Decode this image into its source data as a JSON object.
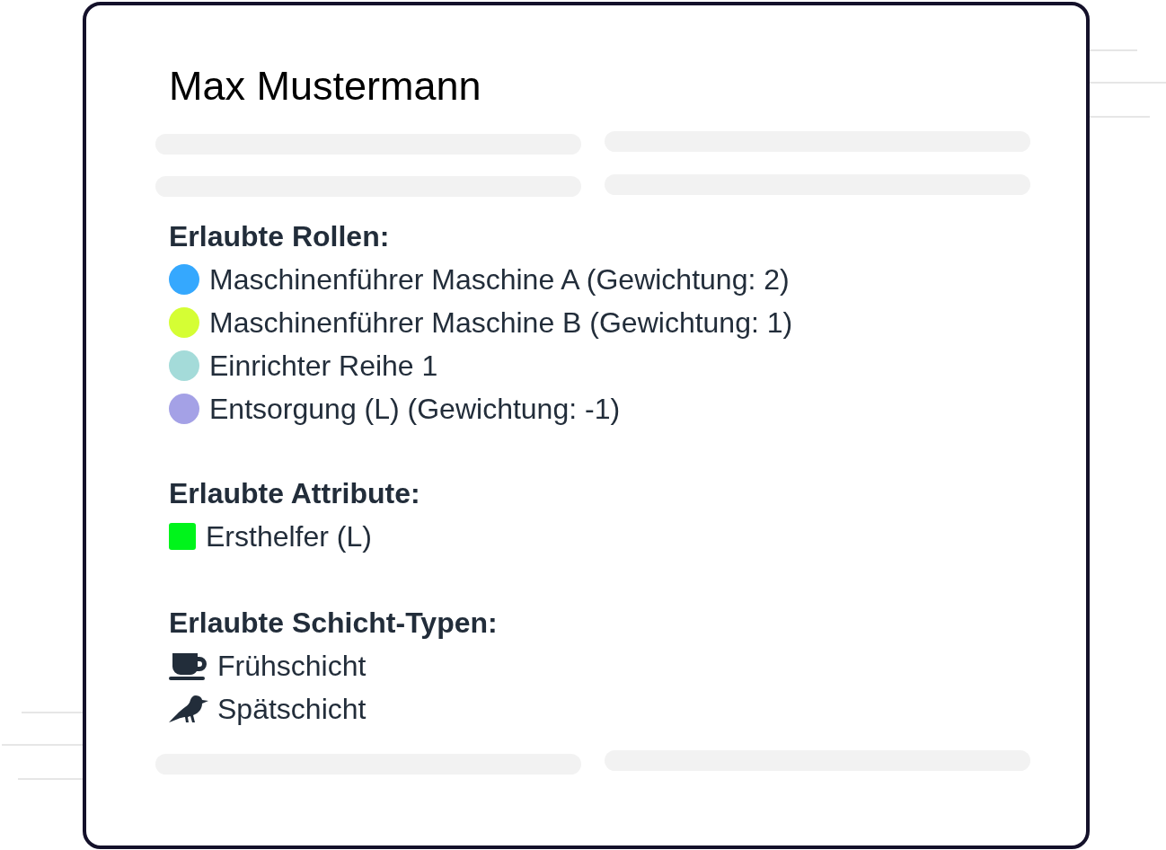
{
  "name": "Max Mustermann",
  "roles": {
    "heading": "Erlaubte Rollen:",
    "items": [
      {
        "label": "Maschinenführer Maschine A (Gewichtung: 2)",
        "color": "#35a8fe"
      },
      {
        "label": "Maschinenführer Maschine B (Gewichtung: 1)",
        "color": "#d5fe34"
      },
      {
        "label": "Einrichter Reihe 1",
        "color": "#a4dbd9"
      },
      {
        "label": "Entsorgung (L) (Gewichtung: -1)",
        "color": "#a4a1e6"
      }
    ]
  },
  "attributes": {
    "heading": "Erlaubte Attribute:",
    "items": [
      {
        "label": "Ersthelfer (L)",
        "color": "#00f41b"
      }
    ]
  },
  "shift_types": {
    "heading": "Erlaubte Schicht-Typen:",
    "items": [
      {
        "label": "Frühschicht",
        "kind": "cup"
      },
      {
        "label": "Spätschicht",
        "kind": "bird"
      }
    ]
  }
}
